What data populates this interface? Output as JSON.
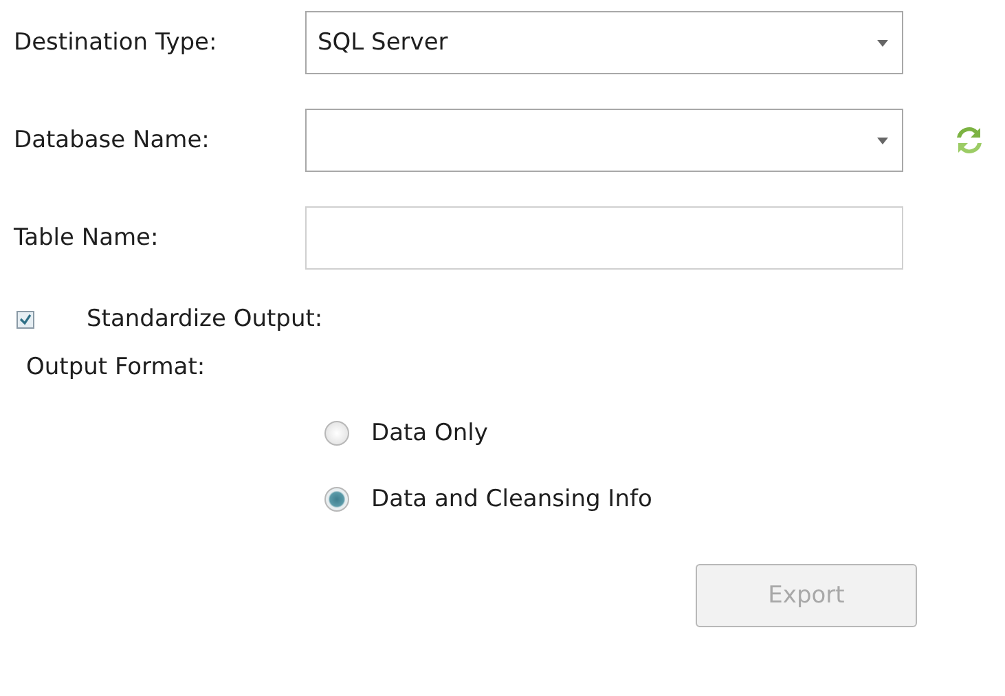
{
  "fields": [
    {
      "kind": "dropdown",
      "label": "Destination Type:",
      "value": "SQL Server",
      "refresh": false
    },
    {
      "kind": "dropdown",
      "label": "Database Name:",
      "refresh": true
    },
    {
      "kind": "text",
      "label": "Table Name:",
      "refresh": false
    }
  ],
  "standardize": {
    "label": "Standardize Output:",
    "checked": true
  },
  "output_format": {
    "label": "Output Format:",
    "options": [
      {
        "label": "Data Only",
        "selected": false
      },
      {
        "label": "Data and Cleansing Info",
        "selected": true
      }
    ]
  },
  "export_button": {
    "label": "Export",
    "disabled": true
  }
}
